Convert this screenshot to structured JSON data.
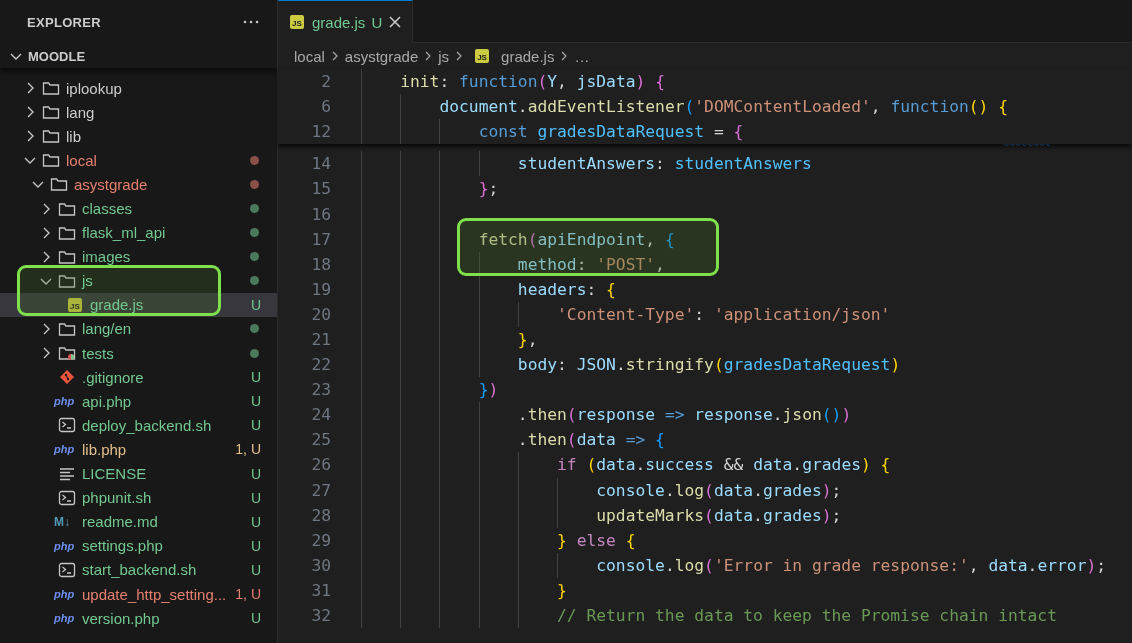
{
  "sidebar": {
    "title": "EXPLORER",
    "section": {
      "label": "MOODLE",
      "expanded": true
    },
    "tree": [
      {
        "label": "iplookup",
        "kind": "folder",
        "expanded": false,
        "color": "#cccccc",
        "selected": false
      },
      {
        "label": "lang",
        "kind": "folder",
        "expanded": false,
        "color": "#cccccc",
        "selected": false
      },
      {
        "label": "lib",
        "kind": "folder",
        "expanded": false,
        "color": "#cccccc",
        "selected": false
      },
      {
        "label": "local",
        "kind": "folder",
        "expanded": true,
        "color": "#e5806f",
        "dot": true,
        "selected": false,
        "children": [
          {
            "label": "asystgrade",
            "kind": "folder",
            "expanded": true,
            "color": "#e5806f",
            "dot": true,
            "selected": false,
            "children": [
              {
                "label": "classes",
                "kind": "folder",
                "expanded": false,
                "color": "#73c991",
                "dot": true,
                "selected": false
              },
              {
                "label": "flask_ml_api",
                "kind": "folder",
                "expanded": false,
                "color": "#73c991",
                "dot": true,
                "selected": false
              },
              {
                "label": "images",
                "kind": "folder",
                "expanded": false,
                "color": "#73c991",
                "dot": true,
                "selected": false
              },
              {
                "label": "js",
                "kind": "folder",
                "expanded": true,
                "color": "#73c991",
                "dot": true,
                "selected": false,
                "children": [
                  {
                    "label": "grade.js",
                    "kind": "js",
                    "icon_text": "JS",
                    "color": "#73c991",
                    "badge": "U",
                    "selected": true
                  }
                ]
              },
              {
                "label": "lang/en",
                "kind": "folder",
                "expanded": false,
                "color": "#73c991",
                "dot": true,
                "selected": false
              },
              {
                "label": "tests",
                "kind": "test-folder",
                "expanded": false,
                "color": "#73c991",
                "dot": true,
                "selected": false
              },
              {
                "label": ".gitignore",
                "kind": "git",
                "color": "#73c991",
                "badge": "U",
                "selected": false
              },
              {
                "label": "api.php",
                "kind": "php",
                "icon_text": "php",
                "color": "#73c991",
                "badge": "U",
                "selected": false
              },
              {
                "label": "deploy_backend.sh",
                "kind": "shell",
                "color": "#73c991",
                "badge": "U",
                "selected": false
              },
              {
                "label": "lib.php",
                "kind": "php",
                "icon_text": "php",
                "color": "#e2c08d",
                "badge": "1, U",
                "selected": false
              },
              {
                "label": "LICENSE",
                "kind": "text",
                "color": "#73c991",
                "badge": "U",
                "selected": false
              },
              {
                "label": "phpunit.sh",
                "kind": "shell",
                "color": "#73c991",
                "badge": "U",
                "selected": false
              },
              {
                "label": "readme.md",
                "kind": "markdown",
                "icon_text": "M↓",
                "color": "#73c991",
                "badge": "U",
                "selected": false
              },
              {
                "label": "settings.php",
                "kind": "php",
                "icon_text": "php",
                "color": "#73c991",
                "badge": "U",
                "selected": false
              },
              {
                "label": "start_backend.sh",
                "kind": "shell",
                "color": "#73c991",
                "badge": "U",
                "selected": false
              },
              {
                "label": "update_http_setting...",
                "kind": "php",
                "icon_text": "php",
                "color": "#e5806f",
                "badge": "1, U",
                "selected": false
              },
              {
                "label": "version.php",
                "kind": "php",
                "icon_text": "php",
                "color": "#73c991",
                "badge": "U",
                "selected": false
              }
            ]
          }
        ]
      }
    ]
  },
  "tabs": [
    {
      "label": "grade.js",
      "icon_text": "JS",
      "badge": "U",
      "selected": true
    }
  ],
  "breadcrumb": [
    {
      "label": "local"
    },
    {
      "label": "asystgrade"
    },
    {
      "label": "js"
    },
    {
      "label": "grade.js",
      "icon_text": "JS"
    },
    {
      "label": "…"
    }
  ],
  "sticky_lines": [
    {
      "number": "2",
      "tokens": [
        {
          "text": "    init",
          "kind": "function"
        },
        {
          "text": ": ",
          "kind": "plain"
        },
        {
          "text": "function",
          "kind": "keyword"
        },
        {
          "text": "(",
          "kind": "bracket2"
        },
        {
          "text": "Y",
          "kind": "variable"
        },
        {
          "text": ", ",
          "kind": "plain"
        },
        {
          "text": "jsData",
          "kind": "variable"
        },
        {
          "text": ")",
          "kind": "bracket2"
        },
        {
          "text": " {",
          "kind": "bracket2"
        }
      ]
    },
    {
      "number": "6",
      "tokens": [
        {
          "text": "        document",
          "kind": "variable"
        },
        {
          "text": ".",
          "kind": "plain"
        },
        {
          "text": "addEventListener",
          "kind": "function"
        },
        {
          "text": "(",
          "kind": "bracket3"
        },
        {
          "text": "'DOMContentLoaded'",
          "kind": "string"
        },
        {
          "text": ", ",
          "kind": "plain"
        },
        {
          "text": "function",
          "kind": "keyword"
        },
        {
          "text": "()",
          "kind": "bracket1"
        },
        {
          "text": " {",
          "kind": "bracket1"
        }
      ]
    },
    {
      "number": "12",
      "tokens": [
        {
          "text": "            const",
          "kind": "keyword"
        },
        {
          "text": " gradesDataRequest",
          "kind": "constant"
        },
        {
          "text": " = ",
          "kind": "plain"
        },
        {
          "text": "{",
          "kind": "bracket2"
        }
      ]
    }
  ],
  "lines": [
    {
      "number": "14",
      "tokens": [
        {
          "text": "                studentAnswers",
          "kind": "variable"
        },
        {
          "text": ": ",
          "kind": "plain"
        },
        {
          "text": "studentAnswers",
          "kind": "constant"
        }
      ]
    },
    {
      "number": "15",
      "tokens": [
        {
          "text": "            }",
          "kind": "bracket2"
        },
        {
          "text": ";",
          "kind": "plain"
        }
      ]
    },
    {
      "number": "16"
    },
    {
      "number": "17",
      "tokens": [
        {
          "text": "            fetch",
          "kind": "function"
        },
        {
          "text": "(",
          "kind": "bracket2"
        },
        {
          "text": "apiEndpoint",
          "kind": "variable"
        },
        {
          "text": ", ",
          "kind": "plain"
        },
        {
          "text": "{",
          "kind": "bracket3"
        }
      ]
    },
    {
      "number": "18",
      "tokens": [
        {
          "text": "                method",
          "kind": "variable"
        },
        {
          "text": ": ",
          "kind": "plain"
        },
        {
          "text": "'POST'",
          "kind": "string"
        },
        {
          "text": ",",
          "kind": "plain"
        }
      ]
    },
    {
      "number": "19",
      "tokens": [
        {
          "text": "                headers",
          "kind": "variable"
        },
        {
          "text": ": ",
          "kind": "plain"
        },
        {
          "text": "{",
          "kind": "bracket1"
        }
      ]
    },
    {
      "number": "20",
      "tokens": [
        {
          "text": "                    'Content-Type'",
          "kind": "string"
        },
        {
          "text": ": ",
          "kind": "plain"
        },
        {
          "text": "'application/json'",
          "kind": "string"
        }
      ]
    },
    {
      "number": "21",
      "tokens": [
        {
          "text": "                }",
          "kind": "bracket1"
        },
        {
          "text": ",",
          "kind": "plain"
        }
      ]
    },
    {
      "number": "22",
      "tokens": [
        {
          "text": "                body",
          "kind": "variable"
        },
        {
          "text": ": ",
          "kind": "plain"
        },
        {
          "text": "JSON",
          "kind": "variable"
        },
        {
          "text": ".",
          "kind": "plain"
        },
        {
          "text": "stringify",
          "kind": "function"
        },
        {
          "text": "(",
          "kind": "bracket1"
        },
        {
          "text": "gradesDataRequest",
          "kind": "constant"
        },
        {
          "text": ")",
          "kind": "bracket1"
        }
      ]
    },
    {
      "number": "23",
      "tokens": [
        {
          "text": "            }",
          "kind": "bracket3"
        },
        {
          "text": ")",
          "kind": "bracket2"
        }
      ]
    },
    {
      "number": "24",
      "tokens": [
        {
          "text": "                .",
          "kind": "plain"
        },
        {
          "text": "then",
          "kind": "function"
        },
        {
          "text": "(",
          "kind": "bracket2"
        },
        {
          "text": "response",
          "kind": "variable"
        },
        {
          "text": " =>",
          "kind": "keyword"
        },
        {
          "text": " response",
          "kind": "variable"
        },
        {
          "text": ".",
          "kind": "plain"
        },
        {
          "text": "json",
          "kind": "function"
        },
        {
          "text": "()",
          "kind": "bracket3"
        },
        {
          "text": ")",
          "kind": "bracket2"
        }
      ]
    },
    {
      "number": "25",
      "tokens": [
        {
          "text": "                .",
          "kind": "plain"
        },
        {
          "text": "then",
          "kind": "function"
        },
        {
          "text": "(",
          "kind": "bracket2"
        },
        {
          "text": "data",
          "kind": "variable"
        },
        {
          "text": " =>",
          "kind": "keyword"
        },
        {
          "text": " {",
          "kind": "bracket3"
        }
      ]
    },
    {
      "number": "26",
      "tokens": [
        {
          "text": "                    if",
          "kind": "control"
        },
        {
          "text": " (",
          "kind": "bracket1"
        },
        {
          "text": "data",
          "kind": "variable"
        },
        {
          "text": ".",
          "kind": "plain"
        },
        {
          "text": "success",
          "kind": "variable"
        },
        {
          "text": " && ",
          "kind": "plain"
        },
        {
          "text": "data",
          "kind": "variable"
        },
        {
          "text": ".",
          "kind": "plain"
        },
        {
          "text": "grades",
          "kind": "variable"
        },
        {
          "text": ")",
          "kind": "bracket1"
        },
        {
          "text": " {",
          "kind": "bracket1"
        }
      ]
    },
    {
      "number": "27",
      "tokens": [
        {
          "text": "                        console",
          "kind": "variable"
        },
        {
          "text": ".",
          "kind": "plain"
        },
        {
          "text": "log",
          "kind": "function"
        },
        {
          "text": "(",
          "kind": "bracket2"
        },
        {
          "text": "data",
          "kind": "variable"
        },
        {
          "text": ".",
          "kind": "plain"
        },
        {
          "text": "grades",
          "kind": "variable"
        },
        {
          "text": ")",
          "kind": "bracket2"
        },
        {
          "text": ";",
          "kind": "plain"
        }
      ]
    },
    {
      "number": "28",
      "tokens": [
        {
          "text": "                        updateMarks",
          "kind": "function"
        },
        {
          "text": "(",
          "kind": "bracket2"
        },
        {
          "text": "data",
          "kind": "variable"
        },
        {
          "text": ".",
          "kind": "plain"
        },
        {
          "text": "grades",
          "kind": "variable"
        },
        {
          "text": ")",
          "kind": "bracket2"
        },
        {
          "text": ";",
          "kind": "plain"
        }
      ]
    },
    {
      "number": "29",
      "tokens": [
        {
          "text": "                    }",
          "kind": "bracket1"
        },
        {
          "text": " else",
          "kind": "control"
        },
        {
          "text": " {",
          "kind": "bracket1"
        }
      ]
    },
    {
      "number": "30",
      "tokens": [
        {
          "text": "                        console",
          "kind": "variable"
        },
        {
          "text": ".",
          "kind": "plain"
        },
        {
          "text": "log",
          "kind": "function"
        },
        {
          "text": "(",
          "kind": "bracket2"
        },
        {
          "text": "'Error in grade response:'",
          "kind": "string"
        },
        {
          "text": ", ",
          "kind": "plain"
        },
        {
          "text": "data",
          "kind": "variable"
        },
        {
          "text": ".",
          "kind": "plain"
        },
        {
          "text": "error",
          "kind": "variable"
        },
        {
          "text": ")",
          "kind": "bracket2"
        },
        {
          "text": ";",
          "kind": "plain"
        }
      ]
    },
    {
      "number": "31",
      "tokens": [
        {
          "text": "                    }",
          "kind": "bracket1"
        }
      ]
    },
    {
      "number": "32",
      "tokens": [
        {
          "text": "                    // Return the data to keep the Promise chain intact",
          "kind": "comment"
        }
      ]
    }
  ]
}
